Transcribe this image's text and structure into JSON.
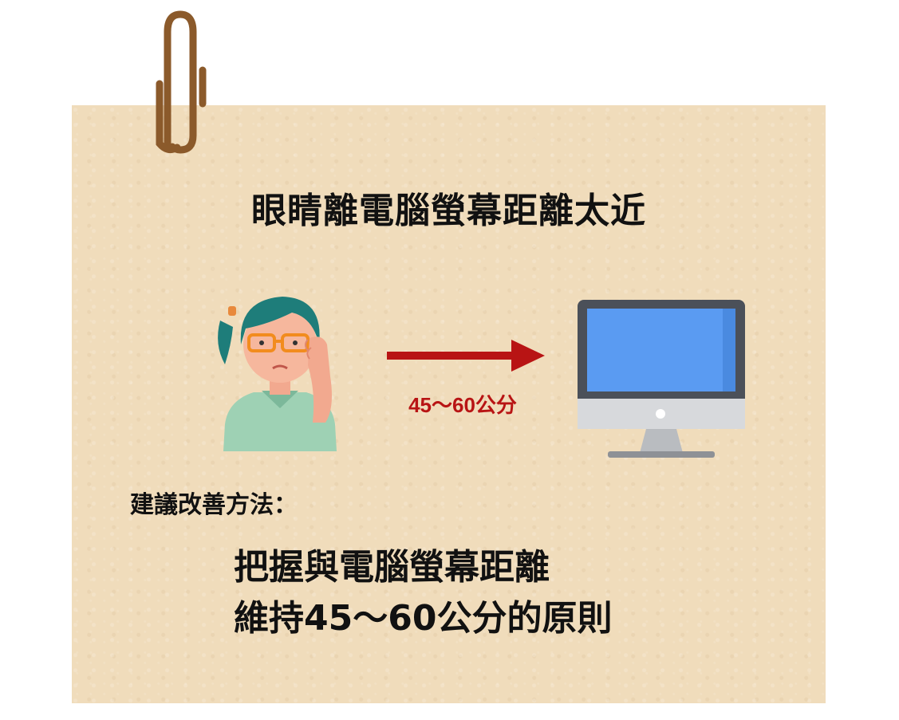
{
  "title": "眼睛離電腦螢幕距離太近",
  "illustration": {
    "person_icon": "woman-with-glasses-icon",
    "arrow_icon": "arrow-right-icon",
    "distance_label": "45～60公分",
    "screen_icon": "computer-monitor-icon"
  },
  "advice": {
    "heading": "建議改善方法：",
    "lines": [
      "把握與電腦螢幕距離",
      "維持45～60公分的原則"
    ]
  },
  "colors": {
    "note_background": "#f0dcbb",
    "paperclip": "#8b5a2b",
    "arrow": "#b81414",
    "distance_text": "#b81414",
    "screen": "#5a9bf2"
  }
}
